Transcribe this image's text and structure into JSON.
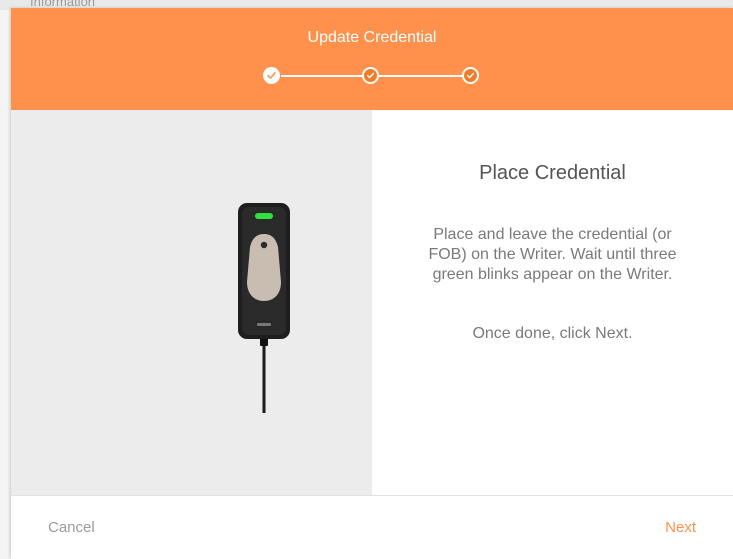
{
  "backdrop": {
    "text": "Information"
  },
  "dialog": {
    "title": "Update Credential",
    "steps": [
      {
        "state": "done",
        "icon": "check-icon"
      },
      {
        "state": "pending",
        "icon": "check-icon"
      },
      {
        "state": "pending",
        "icon": "check-icon"
      }
    ],
    "content": {
      "heading": "Place Credential",
      "instructions": "Place and leave the credential (or FOB) on the Writer. Wait until three green blinks appear on the Writer.",
      "hint": "Once done, click Next."
    },
    "footer": {
      "cancel_label": "Cancel",
      "next_label": "Next"
    }
  },
  "colors": {
    "accent": "#ff914d",
    "writer_led": "#2fe23f"
  }
}
